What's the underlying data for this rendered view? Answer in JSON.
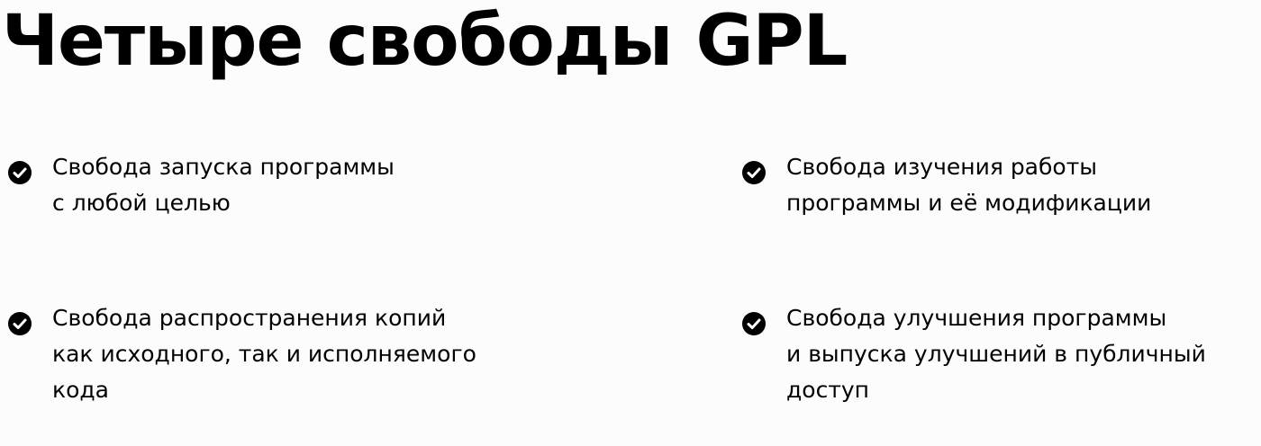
{
  "slide": {
    "title": "Четыре свободы GPL",
    "freedoms": [
      {
        "text": "Свобода запуска программы\nс любой целью",
        "icon": "check-circle-icon"
      },
      {
        "text": "Свобода изучения работы\nпрограммы и её модификации",
        "icon": "check-circle-icon"
      },
      {
        "text": "Свобода распространения копий\nкак исходного, так и исполняемого\nкода",
        "icon": "check-circle-icon"
      },
      {
        "text": "Свобода улучшения программы\nи выпуска улучшений в публичный\nдоступ",
        "icon": "check-circle-icon"
      }
    ]
  },
  "colors": {
    "background": "#fcfcfc",
    "text": "#000000",
    "icon": "#000000"
  }
}
